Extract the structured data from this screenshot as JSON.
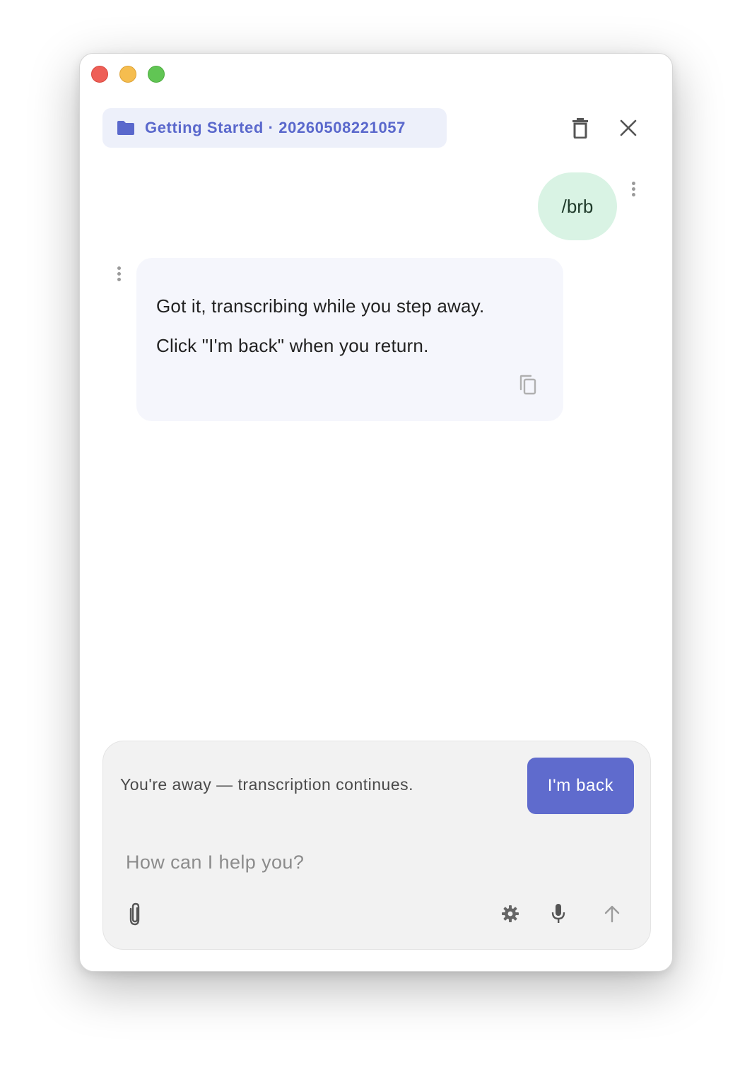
{
  "header": {
    "context_label": "Getting Started · 20260508221057",
    "icons": {
      "folder": "folder-icon",
      "delete": "trash-icon",
      "close": "close-icon"
    },
    "accent_color": "#5a68cc",
    "chip_background": "#edf0fa"
  },
  "messages": [
    {
      "role": "user",
      "text": "/brb",
      "bubble_color": "#d9f3e4"
    },
    {
      "role": "assistant",
      "lines": [
        "Got it, transcribing while you step away.",
        "Click \"I'm back\" when you return."
      ],
      "bubble_color": "#f5f6fc",
      "copy_icon": "copy-icon"
    }
  ],
  "composer": {
    "status_text": "You're away — transcription continues.",
    "back_button_label": "I'm back",
    "back_button_color": "#5f6bcd",
    "placeholder": "How can I help you?",
    "icons": {
      "attach": "paperclip-icon",
      "settings": "gear-icon",
      "voice": "microphone-icon",
      "send": "arrow-up-icon"
    }
  }
}
